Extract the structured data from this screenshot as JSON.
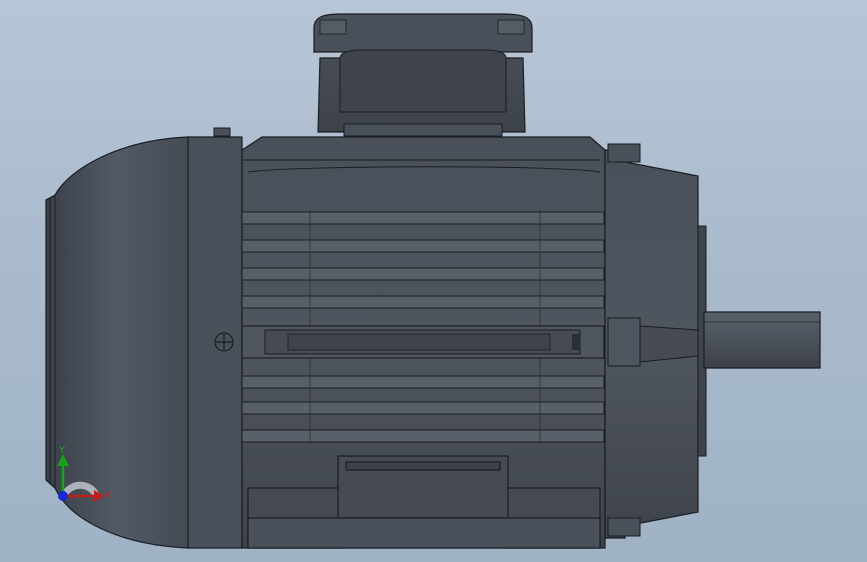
{
  "viewport": {
    "background_top": "#b7c6d7",
    "background_bottom": "#9fb2c6",
    "model_color": "#4a505a",
    "edge_color": "#1a1d22"
  },
  "triad": {
    "x_label": "X",
    "y_label": "Y",
    "x_color": "#c0201a",
    "y_color": "#1aa01a",
    "z_color": "#1a2ad0"
  }
}
